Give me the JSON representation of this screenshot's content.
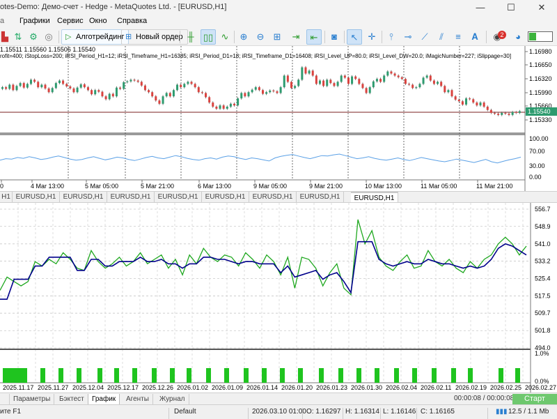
{
  "window": {
    "title": "otes-Demo: Демо-счет - Hedge - MetaQuotes Ltd. - [EURUSD,H1]",
    "minimize": "—",
    "maximize": "☐",
    "close": "✕"
  },
  "menu": {
    "items": [
      "Графики",
      "Сервис",
      "Окно",
      "Справка"
    ]
  },
  "toolbar": {
    "algo_trading": "Алготрейдинг",
    "new_order": "Новый ордер",
    "notifications_count": "2"
  },
  "chart1": {
    "info_line1": "1.15511 1.15560 1.15506 1.15540",
    "info_line2": "rofit=400; iStopLoss=200; iRSI_Period_H1=12; iRSI_Timeframe_H1=16385; iRSI_Period_D1=18; iRSI_Timeframe_D1=16408; iRSI_Level_UP=80.0; iRSI_Level_DW=20.0; iMagicNumber=227; iSlippage=30]",
    "price_labels": [
      "1.16980",
      "1.16650",
      "1.16320",
      "1.15990",
      "1.15660",
      "1.15540",
      "1.15330"
    ],
    "rsi_labels": [
      "100.00",
      "70.00",
      "30.00",
      "0.00"
    ],
    "time_labels": [
      "0",
      "4 Mar 13:00",
      "5 Mar 05:00",
      "5 Mar 21:00",
      "6 Mar 13:00",
      "9 Mar 05:00",
      "9 Mar 21:00",
      "10 Mar 13:00",
      "11 Mar 05:00",
      "11 Mar 21:00"
    ],
    "current_price": "1.15540"
  },
  "chart_tabs": [
    "EURUSD,H1",
    "EURUSD,H1",
    "EURUSD,H1",
    "EURUSD,H1",
    "EURUSD,H1",
    "EURUSD,H1",
    "EURUSD,H1",
    "EURUSD,H1"
  ],
  "chart2": {
    "y_labels": [
      "556.7",
      "548.9",
      "541.0",
      "533.2",
      "525.4",
      "517.5",
      "509.7",
      "501.8",
      "494.0"
    ],
    "volume_labels": [
      "1.0%",
      "0.0%"
    ],
    "date_labels": [
      "2025.11.17",
      "2025.11.27",
      "2025.12.04",
      "2025.12.17",
      "2025.12.26",
      "2026.01.02",
      "2026.01.09",
      "2026.01.14",
      "2026.01.20",
      "2026.01.23",
      "2026.01.30",
      "2026.02.04",
      "2026.02.11",
      "2026.02.19",
      "2026.02.25",
      "2026.02.27"
    ]
  },
  "chart_data": [
    {
      "type": "line",
      "title": "",
      "x": [
        0,
        1,
        2,
        3,
        4,
        5,
        6,
        7,
        8,
        9,
        10,
        11,
        12,
        13,
        14,
        15,
        16,
        17,
        18,
        19,
        20,
        21,
        22,
        23,
        24,
        25,
        26,
        27,
        28,
        29,
        30,
        31,
        32,
        33,
        34,
        35,
        36,
        37,
        38,
        39,
        40,
        41,
        42,
        43,
        44,
        45,
        46,
        47,
        48,
        49,
        50,
        51,
        52,
        53,
        54,
        55,
        56,
        57,
        58,
        59,
        60,
        61,
        62,
        63,
        64,
        65,
        66,
        67,
        68,
        69,
        70,
        71,
        72,
        73,
        74,
        75
      ],
      "series": [
        {
          "name": "",
          "color": "#00aa00",
          "values": [
            520,
            526,
            524,
            522,
            524,
            533,
            531,
            534,
            532,
            537,
            534,
            530,
            529,
            538,
            533,
            530,
            532,
            535,
            531,
            533,
            537,
            532,
            534,
            536,
            530,
            534,
            527,
            536,
            532,
            539,
            535,
            533,
            536,
            535,
            531,
            537,
            534,
            530,
            536,
            533,
            527,
            535,
            521,
            535,
            534,
            530,
            522,
            528,
            532,
            521,
            518,
            552,
            541,
            547,
            535,
            531,
            529,
            533,
            536,
            530,
            531,
            538,
            533,
            531,
            534,
            530,
            528,
            533,
            530,
            534,
            536,
            541,
            544,
            541,
            536,
            540
          ]
        },
        {
          "name": "",
          "color": "#00008b",
          "values": [
            516,
            516,
            525,
            525,
            525,
            531,
            531,
            535,
            535,
            535,
            535,
            529,
            529,
            534,
            534,
            531,
            531,
            533,
            533,
            533,
            535,
            533,
            533,
            534,
            532,
            532,
            530,
            532,
            532,
            535,
            535,
            534,
            534,
            533,
            532,
            533,
            533,
            532,
            532,
            532,
            528,
            531,
            526,
            527,
            528,
            529,
            525,
            527,
            528,
            524,
            519,
            542,
            542,
            542,
            534,
            532,
            531,
            532,
            533,
            532,
            532,
            534,
            533,
            532,
            532,
            531,
            530,
            531,
            530,
            531,
            534,
            539,
            541,
            540,
            538,
            536
          ]
        }
      ],
      "ylim": [
        494.0,
        556.7
      ]
    },
    {
      "type": "line",
      "title": "",
      "series": [
        {
          "name": "",
          "values": [
            44,
            48,
            47,
            51,
            49,
            53,
            50,
            46,
            48,
            52,
            55,
            51,
            47,
            44,
            46,
            50,
            53,
            49,
            45,
            48,
            52,
            50,
            46,
            43,
            47,
            51,
            54,
            50,
            48,
            52,
            56,
            53,
            49,
            46,
            44,
            48,
            50,
            47,
            52,
            55,
            53,
            49,
            46,
            50,
            48,
            45,
            42,
            50,
            54,
            57,
            59,
            55,
            51,
            48,
            52,
            56,
            55,
            58,
            60,
            56,
            52,
            48,
            50,
            53,
            49,
            46,
            44,
            47,
            50,
            46,
            43,
            47,
            51,
            48,
            45,
            42,
            40,
            43,
            47,
            44,
            41,
            38,
            42,
            46,
            40,
            37,
            41,
            45,
            48,
            52
          ]
        }
      ],
      "ylim": [
        0,
        100
      ]
    }
  ],
  "bottom_tabs": [
    "Параметры",
    "Бэктест",
    "График",
    "Агенты",
    "Журнал"
  ],
  "bottom": {
    "timer": "00:00:08 / 00:00:08",
    "start_label": "Старт"
  },
  "status": {
    "help": "ите F1",
    "profile": "Default",
    "datetime": "2026.03.10 01:00",
    "open": "O: 1.16297",
    "high": "H: 1.16314",
    "low": "L: 1.16146",
    "close": "C: 1.16165",
    "network": "12.5 / 1.1 Mb"
  }
}
